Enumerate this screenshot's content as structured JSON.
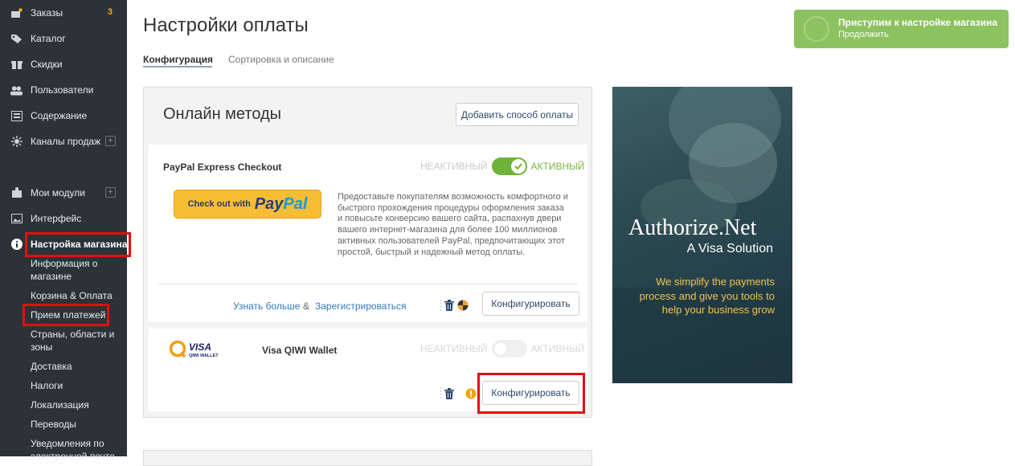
{
  "sidebar": {
    "items": [
      {
        "label": "Заказы",
        "icon": "orders-icon",
        "badge": "3"
      },
      {
        "label": "Каталог",
        "icon": "tag-icon"
      },
      {
        "label": "Скидки",
        "icon": "gift-icon"
      },
      {
        "label": "Пользователи",
        "icon": "users-icon"
      },
      {
        "label": "Содержание",
        "icon": "content-icon"
      },
      {
        "label": "Каналы продаж",
        "icon": "channels-icon",
        "plus": "+"
      },
      {
        "label": "Мои модули",
        "icon": "puzzle-icon",
        "plus": "+"
      },
      {
        "label": "Интерфейс",
        "icon": "image-icon"
      },
      {
        "label": "Настройка магазина",
        "icon": "info-icon"
      }
    ],
    "sub_items": [
      "Информация о магазине",
      "Корзина & Оплата",
      "Прием платежей",
      "Страны, области и зоны",
      "Доставка",
      "Налоги",
      "Локализация",
      "Переводы",
      "Уведомления по электронной почте"
    ]
  },
  "header": {
    "title": "Настройки оплаты",
    "tabs": [
      "Конфигурация",
      "Сортировка и описание"
    ]
  },
  "setup_banner": {
    "title": "Приступим к настройке магазина",
    "subtitle": "Продолжить"
  },
  "online_methods": {
    "title": "Онлайн методы",
    "add_button": "Добавить способ оплаты",
    "methods": [
      {
        "name": "PayPal Express Checkout",
        "inactive_label": "НЕАКТИВНЫЙ",
        "active_label": "АКТИВНЫЙ",
        "active": true,
        "paypal_button": {
          "prefix": "Check out with",
          "pay": "Pay",
          "pal": "Pal"
        },
        "description": "Предоставьте покупателям возможность комфортного и быстрого прохождения процедуры оформления заказа и повысьте конверсию вашего сайта, распахнув двери вашего интернет-магазина для более 100 миллионов активных пользователей PayPal, предпочитающих этот простой, быстрый и надежный метод оплаты.",
        "learn_more": "Узнать больше",
        "amp": "&",
        "register": "Зарегистрироваться",
        "configure": "Конфигурировать"
      },
      {
        "name": "Visa QIWI Wallet",
        "inactive_label": "НЕАКТИВНЫЙ",
        "active_label": "АКТИВНЫЙ",
        "active": false,
        "logo": {
          "visa": "VISA",
          "qiwi": "QIWI WALLET"
        },
        "configure": "Конфигурировать"
      }
    ]
  },
  "ad": {
    "brand": "Authorize.Net",
    "tagline": "A Visa Solution",
    "text": "We simplify the payments process and give you tools to help your business grow"
  },
  "colors": {
    "sidebar_bg": "#2b3338",
    "accent_green": "#8cc25f",
    "highlight_red": "#e01010",
    "link_blue": "#2f7bbf"
  }
}
